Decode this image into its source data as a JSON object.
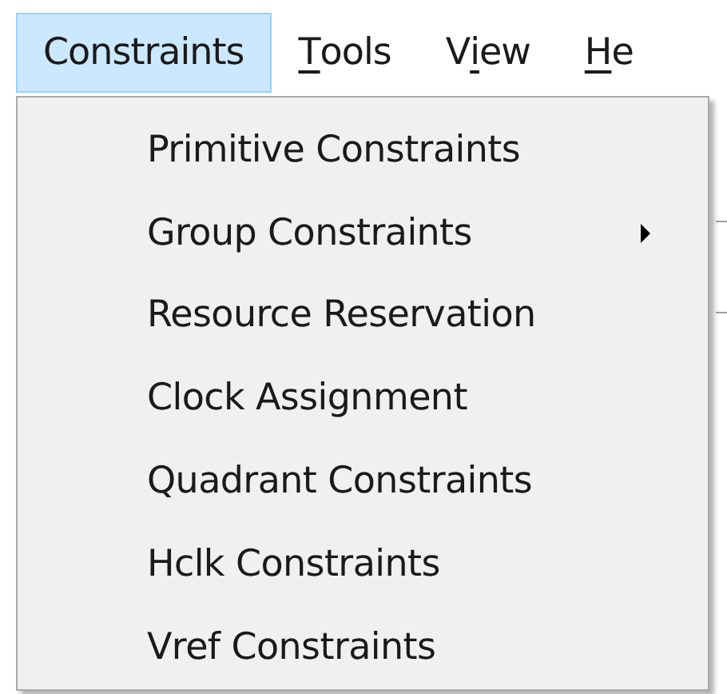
{
  "menubar": [
    {
      "label": "Constraints",
      "selected": true
    },
    {
      "access_key": "T",
      "after": "ools",
      "selected": false
    },
    {
      "before": "V",
      "access_key": "i",
      "after": "ew",
      "selected": false
    },
    {
      "access_key": "H",
      "after": "e",
      "selected": false
    }
  ],
  "menu": {
    "items": [
      {
        "label": "Primitive Constraints",
        "has_submenu": false
      },
      {
        "label": "Group Constraints",
        "has_submenu": true
      },
      {
        "label": "Resource Reservation",
        "has_submenu": false
      },
      {
        "label": "Clock Assignment",
        "has_submenu": false
      },
      {
        "label": "Quadrant Constraints",
        "has_submenu": false
      },
      {
        "label": "Hclk Constraints",
        "has_submenu": false
      },
      {
        "label": "Vref Constraints",
        "has_submenu": false
      }
    ]
  }
}
